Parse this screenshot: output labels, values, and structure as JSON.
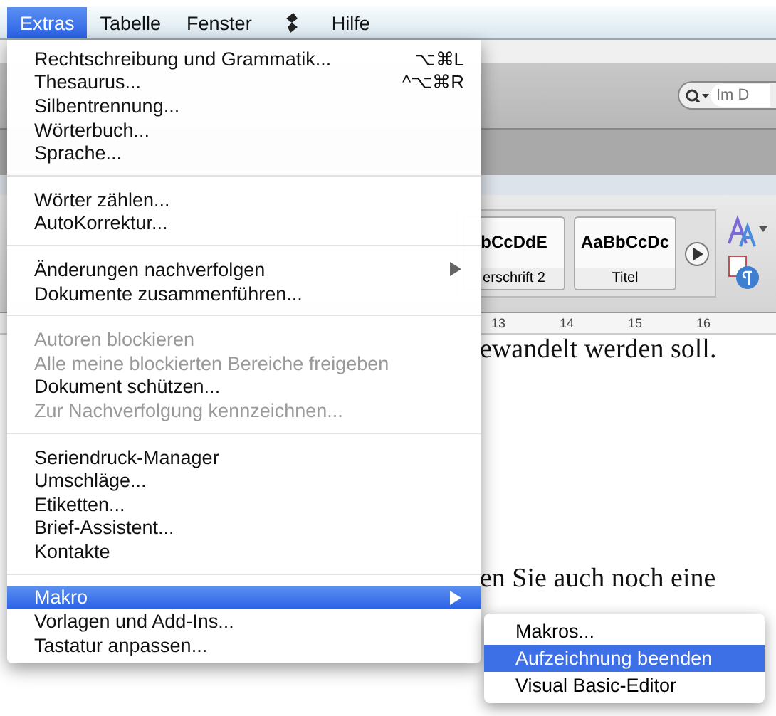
{
  "menubar": [
    {
      "kind": "text",
      "label": "Extras",
      "selected": true
    },
    {
      "kind": "text",
      "label": "Tabelle",
      "selected": false
    },
    {
      "kind": "text",
      "label": "Fenster",
      "selected": false
    },
    {
      "kind": "icon",
      "selected": false
    },
    {
      "kind": "text",
      "label": "Hilfe",
      "selected": false
    }
  ],
  "background": {
    "search": {
      "placeholder": "Im D"
    },
    "styles": [
      {
        "preview": "bCcDdE",
        "name": "erschrift 2"
      },
      {
        "preview": "AaBbCcDc",
        "name": "Titel"
      }
    ],
    "ruler": [
      "13",
      "14",
      "15",
      "16"
    ],
    "document_lines": [
      "ewandelt werden soll.",
      "en Sie auch noch eine"
    ]
  },
  "menu": {
    "groups": [
      [
        {
          "label": "Rechtschreibung und Grammatik...",
          "shortcut": "⌥⌘L",
          "disabled": false,
          "submenu": false,
          "selected": false
        },
        {
          "label": "Thesaurus...",
          "shortcut": "^⌥⌘R",
          "disabled": false,
          "submenu": false,
          "selected": false
        },
        {
          "label": "Silbentrennung...",
          "disabled": false,
          "submenu": false,
          "selected": false
        },
        {
          "label": "Wörterbuch...",
          "disabled": false,
          "submenu": false,
          "selected": false
        },
        {
          "label": "Sprache...",
          "disabled": false,
          "submenu": false,
          "selected": false
        }
      ],
      [
        {
          "label": "Wörter zählen...",
          "disabled": false,
          "submenu": false,
          "selected": false
        },
        {
          "label": "AutoKorrektur...",
          "disabled": false,
          "submenu": false,
          "selected": false
        }
      ],
      [
        {
          "label": "Änderungen nachverfolgen",
          "disabled": false,
          "submenu": true,
          "selected": false
        },
        {
          "label": "Dokumente zusammenführen...",
          "disabled": false,
          "submenu": false,
          "selected": false
        }
      ],
      [
        {
          "label": "Autoren blockieren",
          "disabled": true,
          "submenu": false,
          "selected": false
        },
        {
          "label": "Alle meine blockierten Bereiche freigeben",
          "disabled": true,
          "submenu": false,
          "selected": false
        },
        {
          "label": "Dokument schützen...",
          "disabled": false,
          "submenu": false,
          "selected": false
        },
        {
          "label": "Zur Nachverfolgung kennzeichnen...",
          "disabled": true,
          "submenu": false,
          "selected": false
        }
      ],
      [
        {
          "label": "Seriendruck-Manager",
          "disabled": false,
          "submenu": false,
          "selected": false
        },
        {
          "label": "Umschläge...",
          "disabled": false,
          "submenu": false,
          "selected": false
        },
        {
          "label": "Etiketten...",
          "disabled": false,
          "submenu": false,
          "selected": false
        },
        {
          "label": "Brief-Assistent...",
          "disabled": false,
          "submenu": false,
          "selected": false
        },
        {
          "label": "Kontakte",
          "disabled": false,
          "submenu": false,
          "selected": false
        }
      ],
      [
        {
          "label": "Makro",
          "disabled": false,
          "submenu": true,
          "selected": true
        },
        {
          "label": "Vorlagen und Add-Ins...",
          "disabled": false,
          "submenu": false,
          "selected": false
        },
        {
          "label": "Tastatur anpassen...",
          "disabled": false,
          "submenu": false,
          "selected": false
        }
      ]
    ]
  },
  "submenu": {
    "items": [
      {
        "label": "Makros...",
        "selected": false
      },
      {
        "label": "Aufzeichnung beenden",
        "selected": true
      },
      {
        "label": "Visual Basic-Editor",
        "selected": false
      }
    ]
  }
}
